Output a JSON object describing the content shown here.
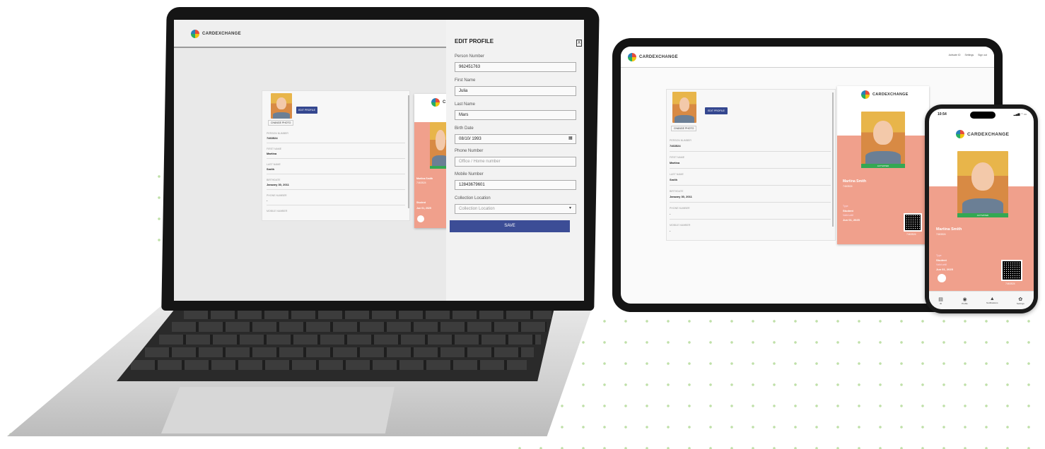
{
  "brand": "CARDEXCHANGE",
  "edit_profile": {
    "title": "EDIT PROFILE",
    "close": "X",
    "fields": [
      {
        "label": "Person Number",
        "value": "962451763"
      },
      {
        "label": "First Name",
        "value": "Julia"
      },
      {
        "label": "Last Name",
        "value": "Mars"
      },
      {
        "label": "Birth Date",
        "value": "08/10/ 1993"
      },
      {
        "label": "Phone Number",
        "value": "",
        "placeholder": "Office / Home number"
      },
      {
        "label": "Mobile Number",
        "value": "12843679601"
      },
      {
        "label": "Collection Location",
        "value": "",
        "placeholder": "Collection Location"
      }
    ],
    "save_label": "SAVE"
  },
  "laptop_profile": {
    "edit_button": "EDIT PROFILE",
    "change_photo": "CHANGE PHOTO",
    "rows": [
      {
        "label": "PERSON NUMBER",
        "value": "7463524"
      },
      {
        "label": "FIRST NAME",
        "value": "Martina"
      },
      {
        "label": "LAST NAME",
        "value": "Smith"
      },
      {
        "label": "BIRTHDATE",
        "value": "January 30, 2011"
      },
      {
        "label": "PHONE NUMBER",
        "value": "-"
      },
      {
        "label": "MOBILE NUMBER",
        "value": ""
      }
    ],
    "card_name": "Martina Smith",
    "card_number": "7463524",
    "card_type": "Student",
    "card_expiry": "Jun 01, 2025",
    "card_brand_partial": "Ca"
  },
  "tablet": {
    "nav": [
      "Activate ID",
      "Settings",
      "Sign out"
    ],
    "edit_button": "EDIT PROFILE",
    "change_photo": "CHANGE PHOTO",
    "rows": [
      {
        "label": "PERSON NUMBER",
        "value": "7463524"
      },
      {
        "label": "FIRST NAME",
        "value": "Martina"
      },
      {
        "label": "LAST NAME",
        "value": "Smith"
      },
      {
        "label": "BIRTHDATE",
        "value": "January 30, 2011"
      },
      {
        "label": "PHONE NUMBER",
        "value": "-"
      },
      {
        "label": "MOBILE NUMBER",
        "value": "-"
      }
    ],
    "card": {
      "status": "ACTIVATED",
      "name": "Martina Smith",
      "number": "7463524",
      "type_label": "Type",
      "type": "Student",
      "expiry_label": "Valid until",
      "expiry": "Jun 01, 2025",
      "qr_caption": "7463524"
    }
  },
  "phone": {
    "time": "10:54",
    "status_icons": "▂▄▆ ◠ ▭",
    "card": {
      "status": "ACTIVATED",
      "name": "Martina Smith",
      "number": "7463524",
      "type_label": "Type",
      "type": "Student",
      "expiry_label": "Valid until",
      "expiry": "Jun 01, 2025",
      "qr_caption": "7463524"
    },
    "tabs": [
      {
        "icon": "id-card-icon",
        "label": "ID"
      },
      {
        "icon": "person-icon",
        "label": "Profile"
      },
      {
        "icon": "bell-icon",
        "label": "Notifications"
      },
      {
        "icon": "gear-icon",
        "label": "Settings"
      }
    ]
  }
}
